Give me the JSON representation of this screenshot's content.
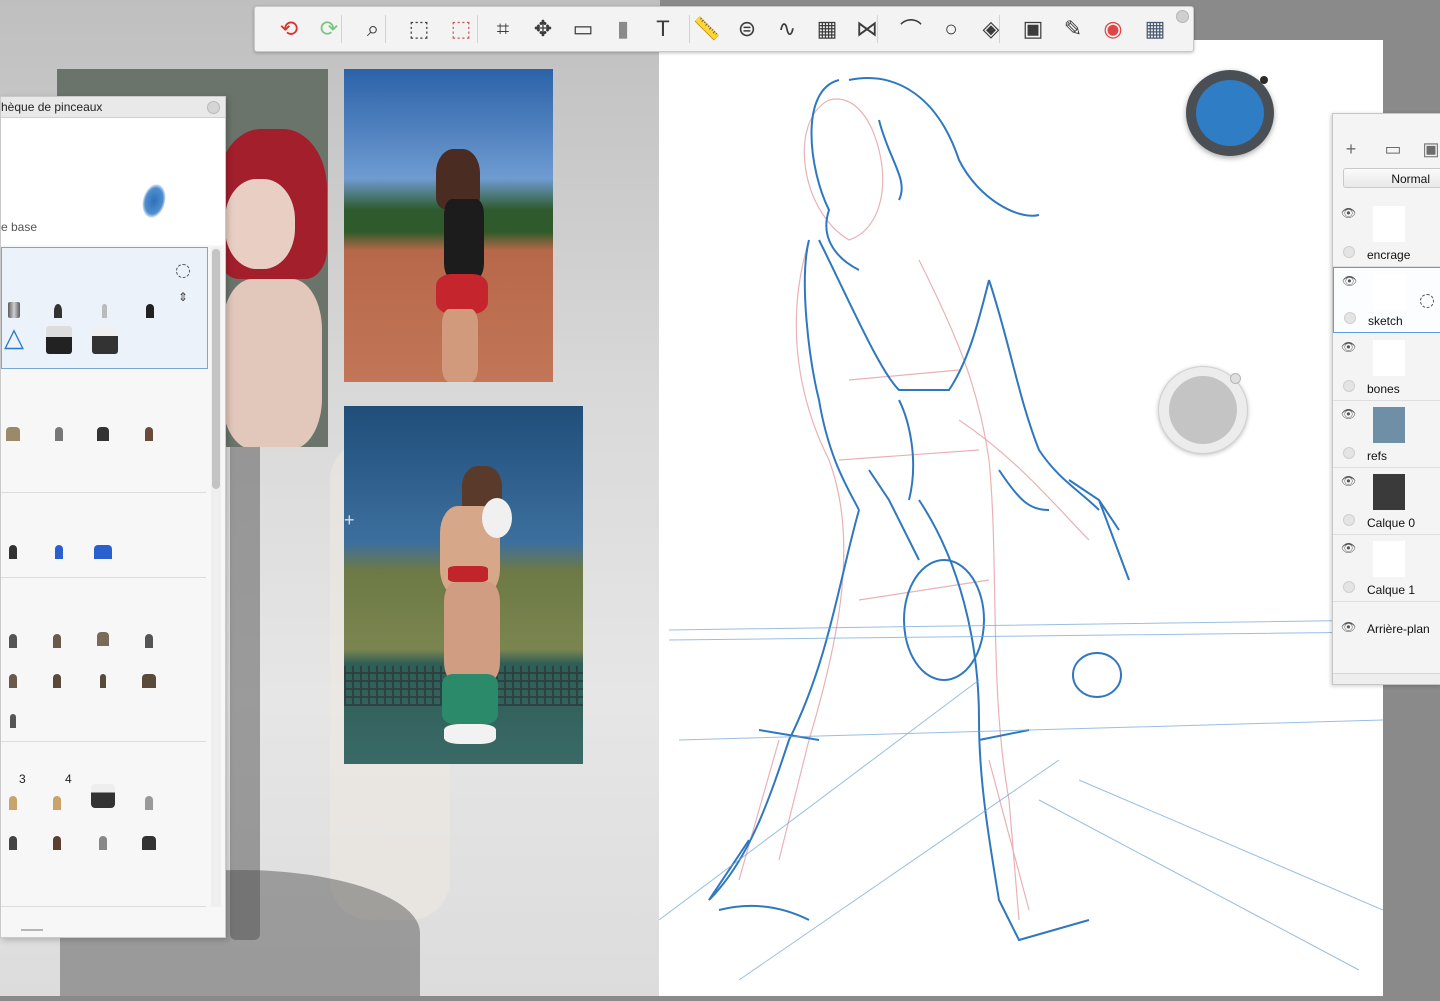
{
  "toolbar": {
    "tools": [
      {
        "name": "undo-icon",
        "glyph": "⟲",
        "color": "#d9342b"
      },
      {
        "name": "redo-icon",
        "glyph": "⟳",
        "color": "#7bc77f"
      },
      {
        "name": "zoom-icon",
        "glyph": "⌕",
        "color": "#3c3c3c"
      },
      {
        "name": "select-icon",
        "glyph": "⬚",
        "color": "#3c3c3c"
      },
      {
        "name": "select-clear-icon",
        "glyph": "⬚",
        "color": "#c65a5a"
      },
      {
        "name": "crop-icon",
        "glyph": "⌗",
        "color": "#3c3c3c"
      },
      {
        "name": "transform-icon",
        "glyph": "✥",
        "color": "#3c3c3c"
      },
      {
        "name": "distort-icon",
        "glyph": "▭",
        "color": "#3c3c3c"
      },
      {
        "name": "fill-icon",
        "glyph": "▮",
        "color": "#8a8a8a"
      },
      {
        "name": "text-icon",
        "glyph": "T",
        "color": "#3c3c3c"
      },
      {
        "name": "ruler-icon",
        "glyph": "📏",
        "color": "#3c3c3c"
      },
      {
        "name": "ellipse-guide-icon",
        "glyph": "⊜",
        "color": "#3c3c3c"
      },
      {
        "name": "french-curve-icon",
        "glyph": "∿",
        "color": "#3c3c3c"
      },
      {
        "name": "perspective-icon",
        "glyph": "▦",
        "color": "#3c3c3c"
      },
      {
        "name": "symmetry-icon",
        "glyph": "⋈",
        "color": "#3c3c3c"
      },
      {
        "name": "stroke-tool-icon",
        "glyph": "⌒",
        "color": "#3c3c3c"
      },
      {
        "name": "shape-circle-icon",
        "glyph": "○",
        "color": "#3c3c3c"
      },
      {
        "name": "shapes-icon",
        "glyph": "◈",
        "color": "#3c3c3c"
      },
      {
        "name": "copic-library-icon",
        "glyph": "▣",
        "color": "#3c3c3c"
      },
      {
        "name": "brush-library-icon",
        "glyph": "✎",
        "color": "#3c3c3c"
      },
      {
        "name": "color-wheel-icon",
        "glyph": "◉",
        "color": "#e04444"
      },
      {
        "name": "layers-toggle-icon",
        "glyph": "▦",
        "color": "#4a5a70"
      }
    ]
  },
  "brush_library": {
    "title": "hèque de pinceaux",
    "preview_name": "e base",
    "stroke_color": "#2f6fb6",
    "set5_numbers": [
      "3",
      "4"
    ]
  },
  "color_puck": {
    "color": "#2f7dc5"
  },
  "layers": {
    "blend_mode": "Normal",
    "items": [
      {
        "name": "encrage",
        "selected": false
      },
      {
        "name": "sketch",
        "selected": true
      },
      {
        "name": "bones",
        "selected": false
      },
      {
        "name": "refs",
        "selected": false
      },
      {
        "name": "Calque 0",
        "selected": false
      },
      {
        "name": "Calque 1",
        "selected": false
      },
      {
        "name": "Arrière-plan",
        "selected": false
      }
    ]
  }
}
